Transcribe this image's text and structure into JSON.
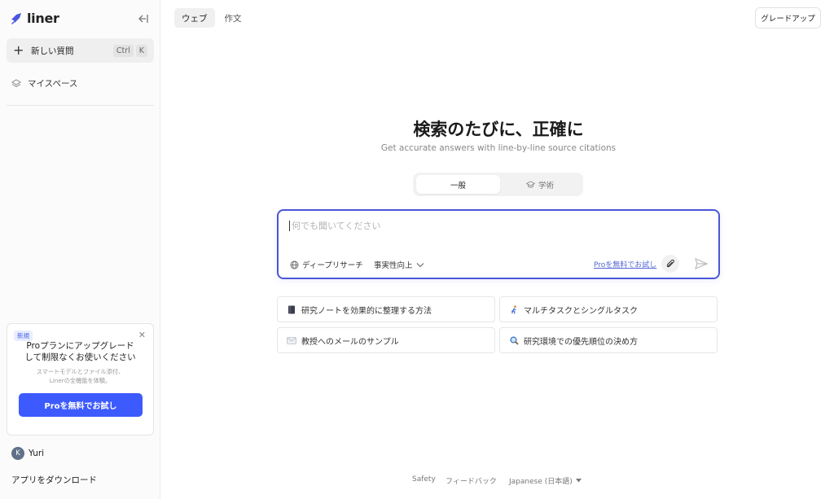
{
  "sidebar": {
    "logo_text": "liner",
    "new_question": {
      "label": "新しい質問",
      "kbd1": "Ctrl",
      "kbd2": "K"
    },
    "myspace_label": "マイスペース",
    "promo": {
      "badge": "新規",
      "title_line1": "Proプランにアップグレード",
      "title_line2": "して制限なくお使いください",
      "sub_line1": "スマートモデルとファイル添付、",
      "sub_line2": "Linerの全機能を体験。",
      "cta": "Proを無料でお試し"
    },
    "user": {
      "initial": "K",
      "name": "Yuri"
    },
    "download_label": "アプリをダウンロード"
  },
  "header": {
    "tabs": [
      {
        "label": "ウェブ"
      },
      {
        "label": "作文"
      }
    ],
    "upgrade_label": "グレードアップ"
  },
  "main": {
    "headline": "検索のたびに、正確に",
    "subline": "Get accurate answers with line-by-line source citations",
    "modes": [
      {
        "label": "一般"
      },
      {
        "label": "学術"
      }
    ],
    "search": {
      "placeholder": "何でも聞いてください",
      "deep_research": "ディープリサーチ",
      "factuality": "事実性向上",
      "pro_link": "Proを無料でお試し"
    },
    "suggestions": [
      {
        "label": "研究ノートを効果的に整理する方法",
        "icon": "notebook-icon"
      },
      {
        "label": "マルチタスクとシングルタスク",
        "icon": "runner-icon"
      },
      {
        "label": "教授へのメールのサンプル",
        "icon": "envelope-icon"
      },
      {
        "label": "研究環境での優先順位の決め方",
        "icon": "magnifier-icon"
      }
    ]
  },
  "footer": {
    "safety": "Safety",
    "feedback": "フィードバック",
    "language": "Japanese (日本語)"
  },
  "colors": {
    "accent": "#3d5afe",
    "search_border": "#4b56d8",
    "link": "#5568d6"
  }
}
